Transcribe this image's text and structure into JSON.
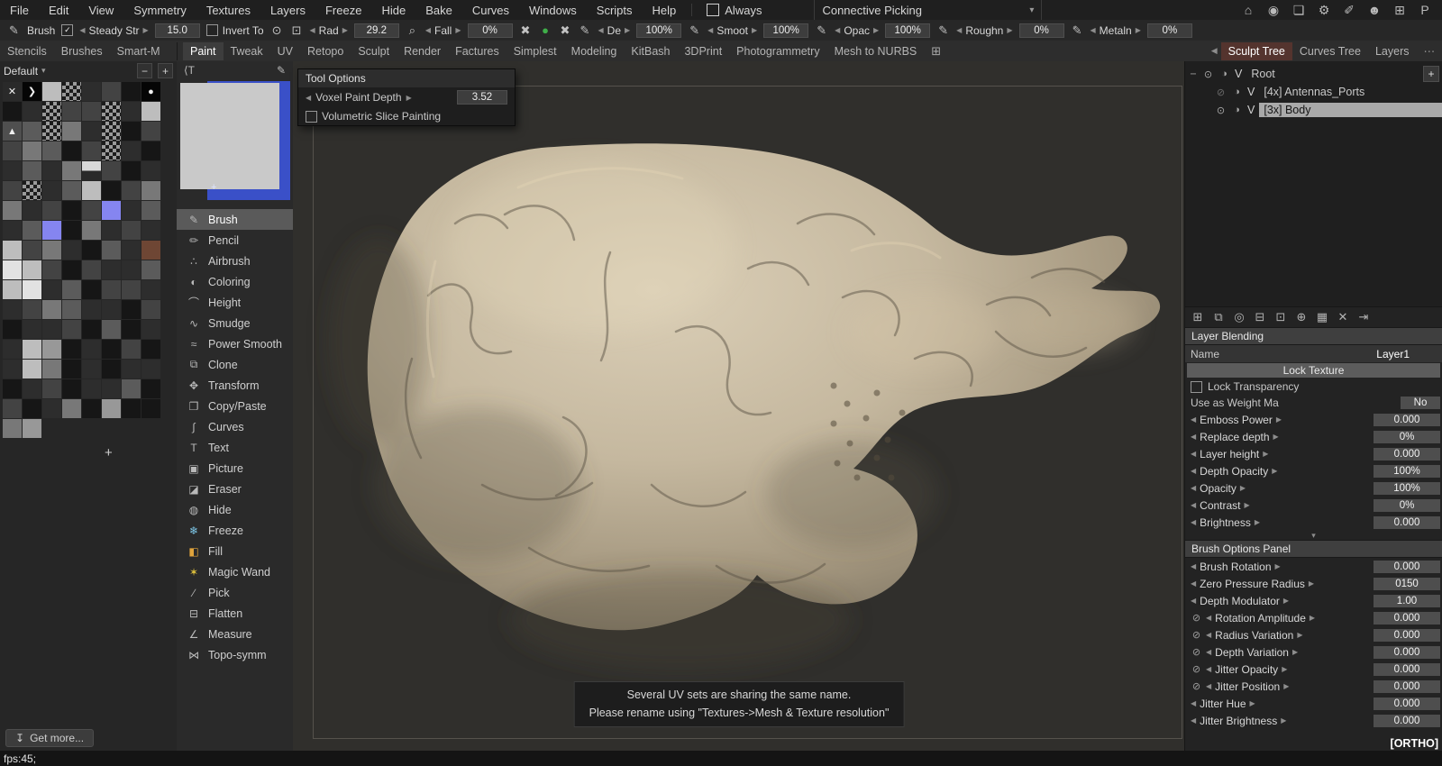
{
  "icons": {
    "left": "◀",
    "right": "▶",
    "down": "▾",
    "check": "✓",
    "close": "✕",
    "dot": "●",
    "arrow_tile": "❯",
    "triangle": "▲",
    "plus": "+",
    "minus": "−",
    "more": "⋯",
    "download": "↧",
    "pen_pressure": "⊘",
    "scroll_more": "▾",
    "expand": "−",
    "add_alpha": "+"
  },
  "menubar": {
    "items": [
      "File",
      "Edit",
      "View",
      "Symmetry",
      "Textures",
      "Layers",
      "Freeze",
      "Hide",
      "Bake",
      "Curves",
      "Windows",
      "Scripts",
      "Help"
    ],
    "always_label": "Always",
    "picking_label": "Connective Picking",
    "right_icons": [
      {
        "g": "⌂",
        "n": "home-icon"
      },
      {
        "g": "◉",
        "n": "sphere-icon"
      },
      {
        "g": "❏",
        "n": "chat-icon"
      },
      {
        "g": "⚙",
        "n": "settings-icon"
      },
      {
        "g": "✐",
        "n": "paint-icon"
      },
      {
        "g": "☻",
        "n": "community-icon"
      },
      {
        "g": "⊞",
        "n": "layout-icon"
      },
      {
        "g": "P",
        "n": "pose-icon"
      }
    ]
  },
  "toolbar": {
    "items": [
      {
        "t": "icon",
        "g": "✎",
        "n": "brush-tool-icon"
      },
      {
        "t": "label",
        "v": "Brush",
        "n": "active-tool-label"
      },
      {
        "t": "check",
        "on": true,
        "n": "pressure-checkbox"
      },
      {
        "t": "spin",
        "v": "Steady Str",
        "n": "steady-stroke-spinner"
      },
      {
        "t": "val",
        "v": "15.0",
        "n": "steady-stroke-value"
      },
      {
        "t": "check",
        "on": false,
        "v": "Invert To",
        "n": "invert-tool-checkbox"
      },
      {
        "t": "icon",
        "g": "⊙",
        "n": "picker-icon"
      },
      {
        "t": "icon",
        "g": "⊡",
        "n": "frame-icon"
      },
      {
        "t": "spin",
        "v": "Rad",
        "n": "radius-spinner"
      },
      {
        "t": "val",
        "v": "29.2",
        "n": "radius-value"
      },
      {
        "t": "icon",
        "g": "⌕",
        "n": "zoom-icon"
      },
      {
        "t": "spin",
        "v": "Fall",
        "n": "falloff-spinner"
      },
      {
        "t": "val",
        "v": "0%",
        "n": "falloff-value"
      },
      {
        "t": "icon",
        "g": "✖",
        "n": "curve-x-icon"
      },
      {
        "t": "icon",
        "g": "●",
        "color": "#3fae49",
        "n": "green-state-icon"
      },
      {
        "t": "icon",
        "g": "✖",
        "n": "curve-x2-icon"
      },
      {
        "t": "icon",
        "g": "✎",
        "n": "depth-pen-icon"
      },
      {
        "t": "spin",
        "v": "De",
        "n": "depth-spinner"
      },
      {
        "t": "val",
        "v": "100%",
        "n": "depth-value"
      },
      {
        "t": "icon",
        "g": "✎",
        "n": "smooth-pen-icon"
      },
      {
        "t": "spin",
        "v": "Smoot",
        "n": "smoothing-spinner"
      },
      {
        "t": "val",
        "v": "100%",
        "n": "smoothing-value"
      },
      {
        "t": "icon",
        "g": "✎",
        "n": "opacity-pen-icon"
      },
      {
        "t": "spin",
        "v": "Opac",
        "n": "opacity-spinner"
      },
      {
        "t": "val",
        "v": "100%",
        "n": "opacity-value"
      },
      {
        "t": "icon",
        "g": "✎",
        "n": "rough-pen-icon"
      },
      {
        "t": "spin",
        "v": "Roughn",
        "n": "roughness-spinner"
      },
      {
        "t": "val",
        "v": "0%",
        "n": "roughness-value"
      },
      {
        "t": "icon",
        "g": "✎",
        "n": "metal-pen-icon"
      },
      {
        "t": "spin",
        "v": "Metaln",
        "n": "metalness-spinner"
      },
      {
        "t": "val",
        "v": "0%",
        "n": "metalness-value"
      }
    ]
  },
  "tabs": {
    "left": [
      {
        "label": "Stencils"
      },
      {
        "label": "Brushes"
      },
      {
        "label": "Smart-M"
      }
    ],
    "main": [
      {
        "label": "Paint",
        "active": true
      },
      {
        "label": "Tweak"
      },
      {
        "label": "UV"
      },
      {
        "label": "Retopo"
      },
      {
        "label": "Sculpt"
      },
      {
        "label": "Render"
      },
      {
        "label": "Factures"
      },
      {
        "label": "Simplest"
      },
      {
        "label": "Modeling"
      },
      {
        "label": "KitBash"
      },
      {
        "label": "3DPrint"
      },
      {
        "label": "Photogrammetry"
      },
      {
        "label": "Mesh to NURBS"
      }
    ],
    "plus": "⊞",
    "right": [
      {
        "label": "Sculpt Tree",
        "active": true
      },
      {
        "label": "Curves Tree"
      },
      {
        "label": "Layers"
      }
    ]
  },
  "stencils": {
    "preset": "Default",
    "palette": {
      "0": "#000000",
      "1": "#161616",
      "2": "#2d2d2d",
      "3": "#434343",
      "4": "#5b5b5b",
      "5": "#787878",
      "6": "#989898",
      "7": "#bdbdbd",
      "8": "#e2e2e2",
      "9": "#f7f7f7",
      "b": "#8585f0",
      "r": "#6e4634",
      "d": "#241b12"
    },
    "rows": [
      "x>7c231o",
      "12c33c27",
      "t4c52c13",
      "35413c21",
      "2425h312",
      "3c247135",
      "52313b24",
      "24b15232",
      "7352142r",
      "87313224",
      "78241332",
      "23542213",
      "12231412",
      "27612131",
      "27512122",
      "12312241",
      "31251611"
    ],
    "extra_row": "56",
    "get_more": "Get more..."
  },
  "tool_panel": {
    "header_left": "⟨T",
    "header_right": "✎",
    "tools": [
      {
        "icon": "✎",
        "label": "Brush",
        "active": true
      },
      {
        "icon": "✏",
        "label": "Pencil"
      },
      {
        "icon": "∴",
        "label": "Airbrush"
      },
      {
        "icon": "◐",
        "label": "Coloring"
      },
      {
        "icon": "⌒",
        "label": "Height"
      },
      {
        "icon": "∿",
        "label": "Smudge"
      },
      {
        "icon": "≈",
        "label": "Power Smooth"
      },
      {
        "icon": "⧉",
        "label": "Clone"
      },
      {
        "icon": "✥",
        "label": "Transform"
      },
      {
        "icon": "❐",
        "label": "Copy/Paste"
      },
      {
        "icon": "∫",
        "label": "Curves"
      },
      {
        "icon": "T",
        "label": "Text"
      },
      {
        "icon": "▣",
        "label": "Picture"
      },
      {
        "icon": "◪",
        "label": "Eraser"
      },
      {
        "icon": "◍",
        "label": "Hide"
      },
      {
        "icon": "❄",
        "label": "Freeze",
        "color": "#7ec8e8"
      },
      {
        "icon": "◧",
        "label": "Fill",
        "color": "#e0a33c"
      },
      {
        "icon": "✶",
        "label": "Magic Wand",
        "color": "#e0c23c"
      },
      {
        "icon": "∕",
        "label": "Pick"
      },
      {
        "icon": "⊟",
        "label": "Flatten"
      },
      {
        "icon": "∠",
        "label": "Measure"
      },
      {
        "icon": "⋈",
        "label": "Topo-symm"
      }
    ]
  },
  "tool_options": {
    "title": "Tool Options",
    "depth_label": "Voxel Paint Depth",
    "depth_value": "3.52",
    "check_label": "Volumetric Slice Painting"
  },
  "viewport": {
    "message_line1": "Several UV sets are sharing the same name.",
    "message_line2": "Please rename using \"Textures->Mesh & Texture resolution\"",
    "ortho": "[ORTHO]"
  },
  "sculpt_tree": {
    "rows": [
      {
        "level": 0,
        "expander": "−",
        "eye": "⊙",
        "ball": "◑",
        "v": "V",
        "label": "Root"
      },
      {
        "level": 1,
        "eye": "⊘",
        "ghost": true,
        "ball": "◑",
        "v": "V",
        "label": "[4x] Antennas_Ports"
      },
      {
        "level": 1,
        "eye": "⊙",
        "ball": "◑",
        "v": "V",
        "label": "[3x] Body",
        "active": true
      }
    ],
    "add_button": "+",
    "icons": [
      {
        "g": "⊞",
        "n": "add-volume-icon"
      },
      {
        "g": "⧉",
        "n": "duplicate-icon"
      },
      {
        "g": "◎",
        "n": "sphere-icon"
      },
      {
        "g": "⊟",
        "n": "subtract-icon"
      },
      {
        "g": "⊡",
        "n": "bake-icon"
      },
      {
        "g": "⊕",
        "n": "merge-icon"
      },
      {
        "g": "▦",
        "n": "voxel-grid-icon"
      },
      {
        "g": "✕",
        "n": "delete-icon"
      },
      {
        "g": "⇥",
        "n": "export-icon"
      }
    ]
  },
  "layer_blending": {
    "title": "Layer Blending",
    "name_label": "Name",
    "name_value": "Layer1",
    "lock_texture": "Lock Texture",
    "lock_transparency": "Lock Transparency",
    "weight_label": "Use as Weight Ma",
    "weight_value": "No",
    "spinners": [
      {
        "label": "Emboss Power",
        "value": "0.000"
      },
      {
        "label": "Replace depth",
        "value": "0%"
      },
      {
        "label": "Layer height",
        "value": "0.000"
      },
      {
        "label": "Depth Opacity",
        "value": "100%"
      },
      {
        "label": "Opacity",
        "value": "100%"
      },
      {
        "label": "Contrast",
        "value": "0%"
      },
      {
        "label": "Brightness",
        "value": "0.000"
      }
    ]
  },
  "brush_options": {
    "title": "Brush Options Panel",
    "spinners": [
      {
        "label": "Brush Rotation",
        "value": "0.000"
      },
      {
        "label": "Zero Pressure Radius",
        "value": "0150"
      },
      {
        "label": "Depth Modulator",
        "value": "1.00"
      },
      {
        "label": "Rotation Amplitude",
        "value": "0.000",
        "pen": true
      },
      {
        "label": "Radius Variation",
        "value": "0.000",
        "pen": true
      },
      {
        "label": "Depth Variation",
        "value": "0.000",
        "pen": true
      },
      {
        "label": "Jitter Opacity",
        "value": "0.000",
        "pen": true
      },
      {
        "label": "Jitter Position",
        "value": "0.000",
        "pen": true
      },
      {
        "label": "Jitter Hue",
        "value": "0.000"
      },
      {
        "label": "Jitter Brightness",
        "value": "0.000"
      }
    ]
  },
  "status": {
    "fps": "fps:45;"
  }
}
